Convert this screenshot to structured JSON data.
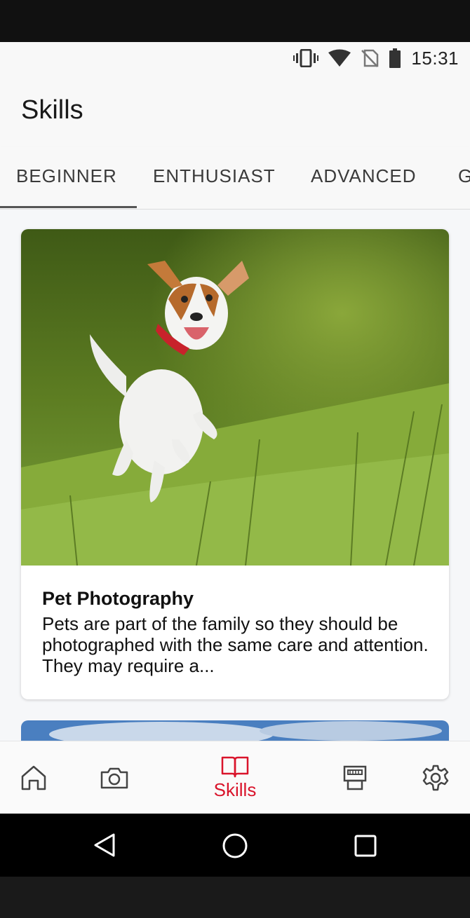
{
  "status_bar": {
    "time": "15:31",
    "icons": [
      "vibrate-icon",
      "wifi-icon",
      "no-sim-icon",
      "battery-icon"
    ]
  },
  "header": {
    "title": "Skills"
  },
  "tabs": [
    {
      "label": "BEGINNER",
      "selected": true
    },
    {
      "label": "ENTHUSIAST",
      "selected": false
    },
    {
      "label": "ADVANCED",
      "selected": false
    },
    {
      "label": "G",
      "selected": false
    }
  ],
  "cards": [
    {
      "title": "Pet Photography",
      "description": "Pets are part of the family so they should be photographed with the same care and attention. They may require a...",
      "image": "dog-running-on-grass"
    }
  ],
  "bottom_nav": {
    "items": [
      {
        "icon": "home-icon",
        "label": ""
      },
      {
        "icon": "camera-icon",
        "label": ""
      },
      {
        "icon": "book-icon",
        "label": "Skills"
      },
      {
        "icon": "photo-printer-icon",
        "label": ""
      },
      {
        "icon": "gear-icon",
        "label": ""
      }
    ],
    "active_color": "#d9142b"
  },
  "system_nav": [
    "back-icon",
    "home-circle-icon",
    "recents-icon"
  ]
}
